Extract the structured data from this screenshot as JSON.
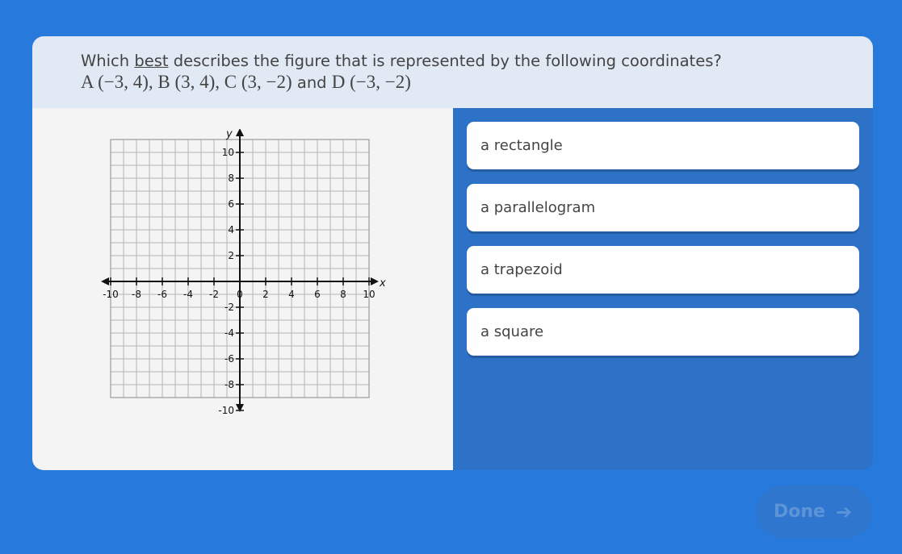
{
  "question": {
    "prefix": "Which ",
    "emphasis": "best",
    "suffix": " describes the figure that is represented by the following coordinates?",
    "coordinates_math_1": "A (−3, 4), B (3, 4), C (3, −2)",
    "coordinates_connector": " and ",
    "coordinates_math_2": "D (−3, −2)"
  },
  "graph": {
    "x_axis_label": "x",
    "y_axis_label": "y",
    "x_tick_labels": [
      "-10",
      "-8",
      "-6",
      "-4",
      "-2",
      "0",
      "2",
      "4",
      "6",
      "8",
      "10"
    ],
    "y_tick_labels": [
      "10",
      "8",
      "6",
      "4",
      "2",
      "-2",
      "-4",
      "-6",
      "-8",
      "-10"
    ]
  },
  "answers": [
    {
      "label": "a rectangle"
    },
    {
      "label": "a parallelogram"
    },
    {
      "label": "a trapezoid"
    },
    {
      "label": "a square"
    }
  ],
  "done_button": {
    "label": "Done",
    "icon": "arrow-right-icon"
  },
  "colors": {
    "background": "#2879dc",
    "question_bar": "#e0e9f4",
    "answer_panel": "#2d72c6",
    "graph_panel": "#f4f4f4"
  }
}
